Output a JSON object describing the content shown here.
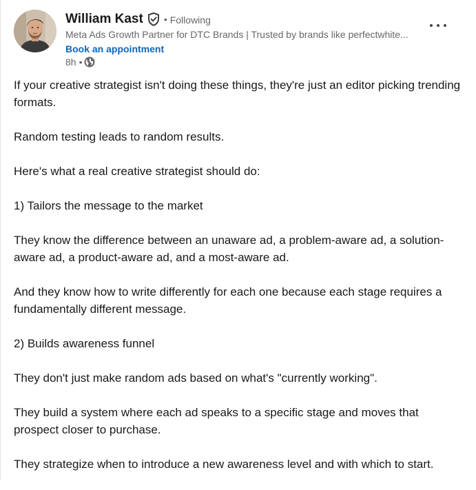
{
  "author": {
    "name": "William Kast",
    "follow_status": "Following",
    "dot": "•",
    "headline": "Meta Ads Growth Partner for DTC Brands | Trusted by brands like perfectwhite...",
    "cta": "Book an appointment",
    "time": "8h",
    "sep": "•",
    "verified_icon": "shield-check-icon",
    "visibility_icon": "globe-icon"
  },
  "menu": {
    "icon": "more-horizontal-icon"
  },
  "post": {
    "paragraphs": [
      "If your creative strategist isn't doing these things, they're just an editor picking trending formats.",
      "Random testing leads to random results.",
      "Here's what a real creative strategist should do:",
      "1) Tailors the message to the market",
      "They know the difference between an unaware ad, a problem-aware ad, a solution-aware ad, a product-aware ad, and a most-aware ad.",
      "And they know how to write differently for each one because each stage requires a fundamentally different message.",
      "2) Builds awareness funnel",
      "They don't just make random ads based on what's \"currently working\".",
      "They build a system where each ad speaks to a specific stage and moves that prospect closer to purchase.",
      "They strategize when to introduce a new awareness level and with which to start."
    ]
  },
  "colors": {
    "link": "#0a66c2",
    "text": "#191919",
    "muted": "#666666"
  }
}
